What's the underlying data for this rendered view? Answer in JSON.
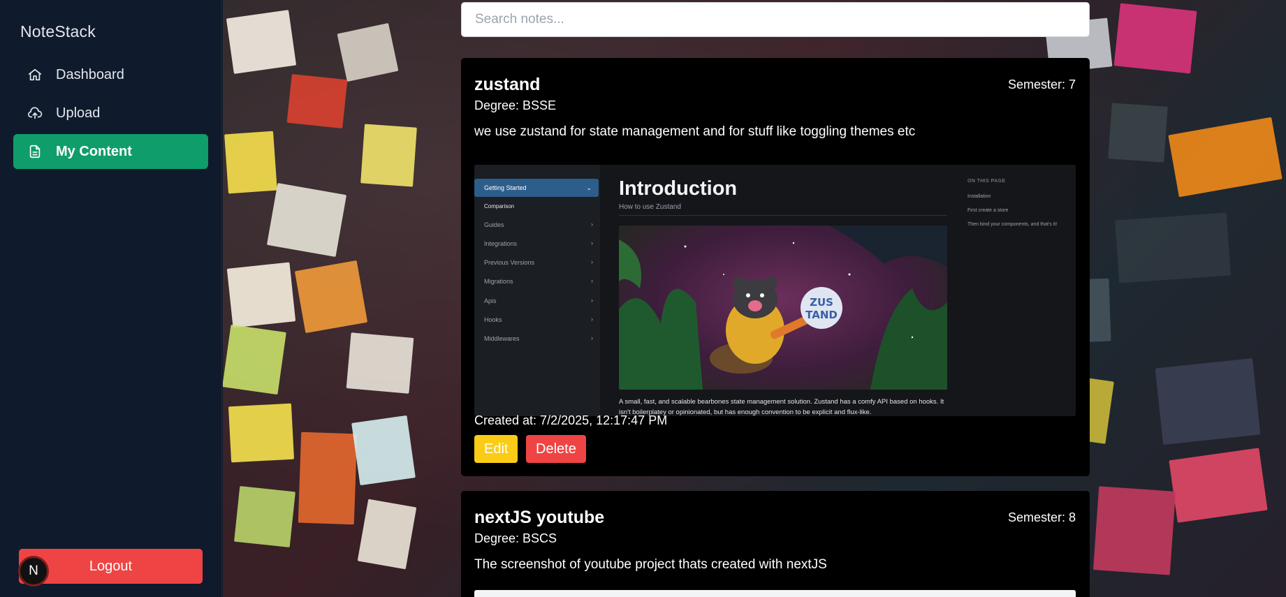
{
  "sidebar": {
    "brand": "NoteStack",
    "items": [
      {
        "label": "Dashboard",
        "icon": "home-icon",
        "active": false
      },
      {
        "label": "Upload",
        "icon": "cloud-upload-icon",
        "active": false
      },
      {
        "label": "My Content",
        "icon": "document-icon",
        "active": true
      }
    ],
    "logout_label": "Logout",
    "avatar_letter": "N"
  },
  "search": {
    "placeholder": "Search notes..."
  },
  "notes": [
    {
      "title": "zustand",
      "semester": "Semester: 7",
      "degree": "Degree: BSSE",
      "description": "we use zustand for state management and for stuff like toggling themes etc",
      "created": "Created at: 7/2/2025, 12:17:47 PM",
      "edit_label": "Edit",
      "delete_label": "Delete",
      "image": {
        "sidebar_active": "Getting Started",
        "sidebar_sub": "Comparison",
        "sidebar_items": [
          "Guides",
          "Integrations",
          "Previous Versions",
          "Migrations",
          "Apis",
          "Hooks",
          "Middlewares"
        ],
        "heading": "Introduction",
        "subheading": "How to use Zustand",
        "mascot_text": "ZUS TAND",
        "caption": "A small, fast, and scalable bearbones state management solution. Zustand has a comfy API based on hooks. It isn't boilerplatey or opinionated, but has enough convention to be explicit and flux-like.",
        "toc_title": "ON THIS PAGE",
        "toc_items": [
          "Installation",
          "First create a store",
          "Then bind your components, and that's it!"
        ]
      }
    },
    {
      "title": "nextJS youtube",
      "semester": "Semester: 8",
      "degree": "Degree: BSCS",
      "description": "The screenshot of youtube project thats created with nextJS"
    }
  ],
  "colors": {
    "sidebar_bg": "#0f1b2d",
    "active_nav": "#0f9d6b",
    "logout": "#ef4444",
    "edit": "#facc15",
    "delete": "#ef4444",
    "card_bg": "#000000"
  }
}
